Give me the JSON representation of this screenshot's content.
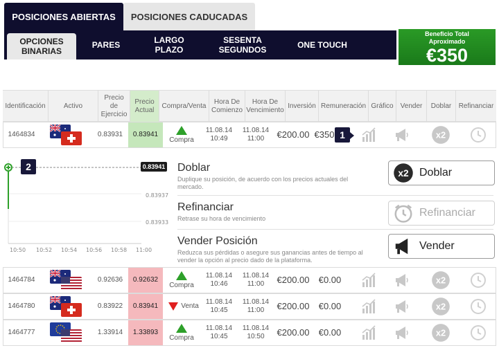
{
  "tabs": {
    "open": "POSICIONES ABIERTAS",
    "expired": "POSICIONES CADUCADAS"
  },
  "subtabs": {
    "binary_l1": "OPCIONES",
    "binary_l2": "BINARIAS",
    "pairs": "PARES",
    "long_l1": "LARGO",
    "long_l2": "PLAZO",
    "sixty_l1": "SESENTA",
    "sixty_l2": "SEGUNDOS",
    "onetouch": "ONE TOUCH"
  },
  "profit": {
    "label_l1": "Beneficio Total",
    "label_l2": "Aproximado",
    "value": "€350"
  },
  "table": {
    "headers": {
      "id": "Identificación",
      "asset": "Activo",
      "strike_l1": "Precio",
      "strike_l2": "de",
      "strike_l3": "Ejercicio",
      "current_l1": "Precio",
      "current_l2": "Actual",
      "direction": "Compra/Venta",
      "start_l1": "Hora De",
      "start_l2": "Comienzo",
      "expiry_l1": "Hora De",
      "expiry_l2": "Vencimiento",
      "investment": "Inversión",
      "payout": "Remuneración",
      "chart": "Gráfico",
      "sell": "Vender",
      "double": "Doblar",
      "refinance": "Refinanciar"
    },
    "rows": [
      {
        "id": "1464834",
        "strike": "0.83931",
        "current": "0.83941",
        "direction": "Compra",
        "start_date": "11.08.14",
        "start_time": "10:49",
        "expiry_date": "11.08.14",
        "expiry_time": "11:00",
        "investment": "€200.00",
        "payout": "€350",
        "badge": "1"
      },
      {
        "id": "1464784",
        "strike": "0.92636",
        "current": "0.92632",
        "direction": "Compra",
        "start_date": "11.08.14",
        "start_time": "10:46",
        "expiry_date": "11.08.14",
        "expiry_time": "11:00",
        "investment": "€200.00",
        "payout": "€0.00"
      },
      {
        "id": "1464780",
        "strike": "0.83922",
        "current": "0.83941",
        "direction": "Venta",
        "start_date": "11.08.14",
        "start_time": "10:45",
        "expiry_date": "11.08.14",
        "expiry_time": "11:00",
        "investment": "€200.00",
        "payout": "€0.00"
      },
      {
        "id": "1464777",
        "strike": "1.33914",
        "current": "1.33893",
        "direction": "Compra",
        "start_date": "11.08.14",
        "start_time": "10:45",
        "expiry_date": "11.08.14",
        "expiry_time": "10:50",
        "investment": "€200.00",
        "payout": "€0.00"
      }
    ]
  },
  "panel": {
    "badge": "2",
    "chart": {
      "current_price": "0.83941",
      "yticks": [
        "0.83937",
        "0.83933"
      ],
      "xticks": [
        "10:50",
        "10:52",
        "10:54",
        "10:56",
        "10:58",
        "11:00"
      ]
    },
    "actions": {
      "double_title": "Doblar",
      "double_desc": "Duplique su posición, de acuerdo con los precios actuales del mercado.",
      "double_button": "Doblar",
      "refinance_title": "Refinanciar",
      "refinance_desc": "Retrase su hora de vencimiento",
      "refinance_button": "Refinanciar",
      "sell_title": "Vender Posición",
      "sell_desc": "Reduzca sus pérdidas o asegure sus ganancias antes de tiempo al vender la opción al precio dado de la plataforma.",
      "sell_button": "Vender"
    }
  },
  "colors": {
    "nav": "#0f0e2e",
    "profit_green": "#1f8a1f",
    "price_up_bg": "#c5e7bb",
    "price_down_bg": "#f5b9bd",
    "up_arrow": "#2ea02a",
    "down_arrow": "#e02020"
  },
  "icons": {
    "chart": "bar-chart-icon",
    "sell": "megaphone-icon",
    "double": "x2-icon",
    "refinance": "clock-icon"
  }
}
